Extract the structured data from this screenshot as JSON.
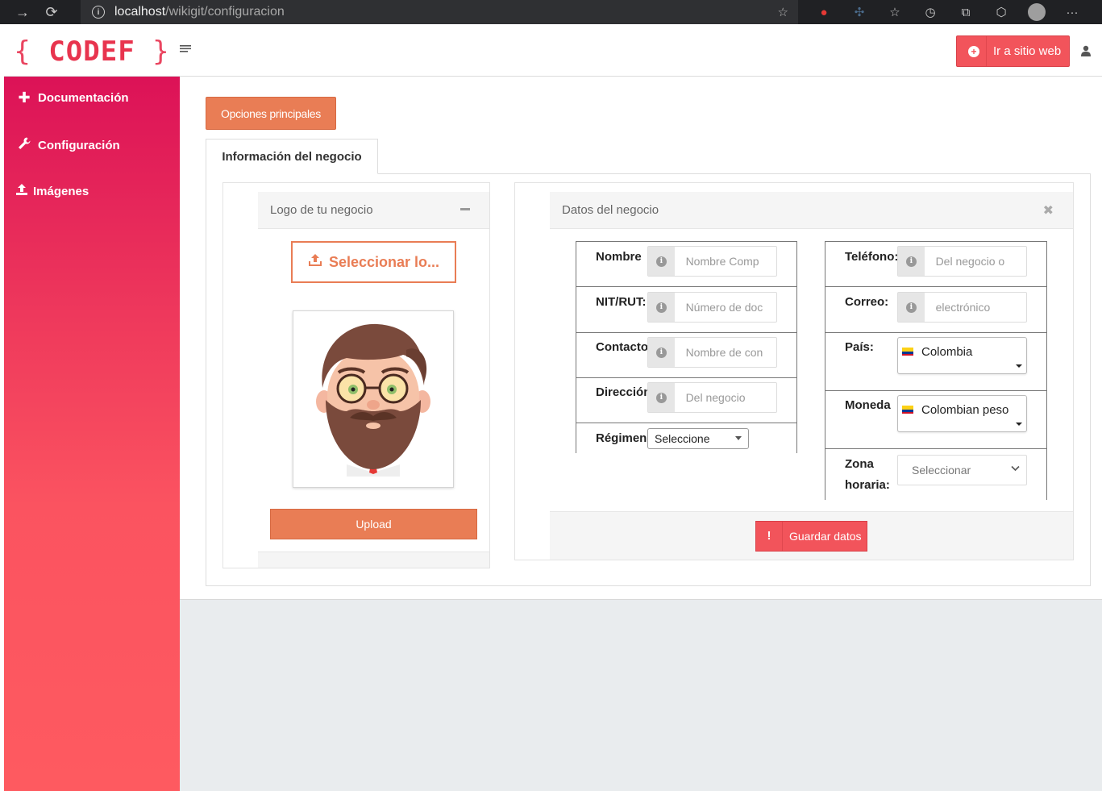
{
  "browser": {
    "url_host": "localhost",
    "url_path": "/wikigit/configuracion"
  },
  "header": {
    "logo_text": "CODEF",
    "site_button_label": "Ir a sitio web"
  },
  "sidebar": {
    "items": [
      {
        "label": "Documentación",
        "icon": "plus-icon"
      },
      {
        "label": "Configuración",
        "icon": "wrench-icon"
      },
      {
        "label": "Imágenes",
        "icon": "upload-icon"
      }
    ]
  },
  "main": {
    "options_button_label": "Opciones principales",
    "tab_label": "Información del negocio"
  },
  "logo_panel": {
    "title": "Logo de tu negocio",
    "select_button_label": "Seleccionar lo...",
    "upload_button_label": "Upload"
  },
  "data_panel": {
    "title": "Datos del negocio",
    "save_button_label": "Guardar datos",
    "left_fields": [
      {
        "label": "Nombre",
        "placeholder": "Nombre Comp"
      },
      {
        "label": "NIT/RUT:",
        "placeholder": "Número de doc"
      },
      {
        "label": "Contacto",
        "placeholder": "Nombre de con"
      },
      {
        "label": "Dirección",
        "placeholder": "Del negocio"
      }
    ],
    "regimen": {
      "label": "Régimen",
      "value": "Seleccione"
    },
    "right_fields": [
      {
        "label": "Teléfono:",
        "placeholder": "Del negocio o"
      },
      {
        "label": "Correo:",
        "placeholder": "electrónico"
      }
    ],
    "pais": {
      "label": "País:",
      "value": "Colombia"
    },
    "moneda": {
      "label": "Moneda",
      "value": "Colombian peso"
    },
    "zona": {
      "label_line1": "Zona",
      "label_line2": "horaria:",
      "value": "Seleccionar"
    }
  },
  "colors": {
    "accent_orange": "#e97d55",
    "accent_red": "#f2545b",
    "sidebar_top": "#dc1257",
    "sidebar_bottom": "#fe5a60"
  }
}
